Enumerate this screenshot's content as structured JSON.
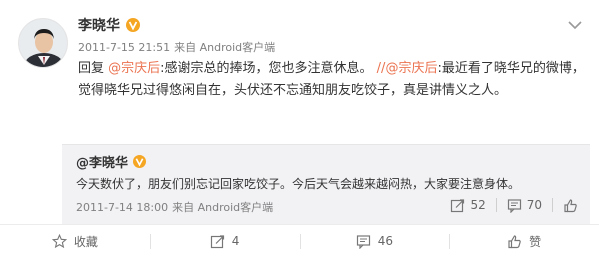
{
  "post": {
    "author": "李晓华",
    "verified_badge_color": "#f5a623",
    "timestamp": "2011-7-15 21:51",
    "source": "来自 Android客户端",
    "content": {
      "reply_prefix": "回复 ",
      "mention1": "@宗庆后",
      "text1": ":感谢宗总的捧场，您也多注意休息。 ",
      "forward_sep": "//",
      "mention2": "@宗庆后",
      "text2": ":最近看了晓华兄的微博，觉得晓华兄过得悠闲自在，头伏还不忘通知朋友吃饺子，真是讲情义之人。"
    }
  },
  "repost": {
    "author": "@李晓华",
    "text": "今天数伏了，朋友们别忘记回家吃饺子。今后天气会越来越闷热，大家要注意身体。",
    "timestamp": "2011-7-14 18:00",
    "source": "来自 Android客户端",
    "forward_count": "52",
    "comment_count": "70"
  },
  "actions": {
    "favorite_label": "收藏",
    "forward_count": "4",
    "comment_count": "46",
    "like_label": "赞"
  },
  "icons": {
    "menu": "chevron-down-icon",
    "verified": "verified-v-icon",
    "favorite": "star-icon",
    "forward": "forward-icon",
    "comment": "comment-icon",
    "like": "thumbs-up-icon"
  },
  "colors": {
    "mention": "#eb7350",
    "repost_bg": "#f2f2f5",
    "muted": "#808080"
  }
}
